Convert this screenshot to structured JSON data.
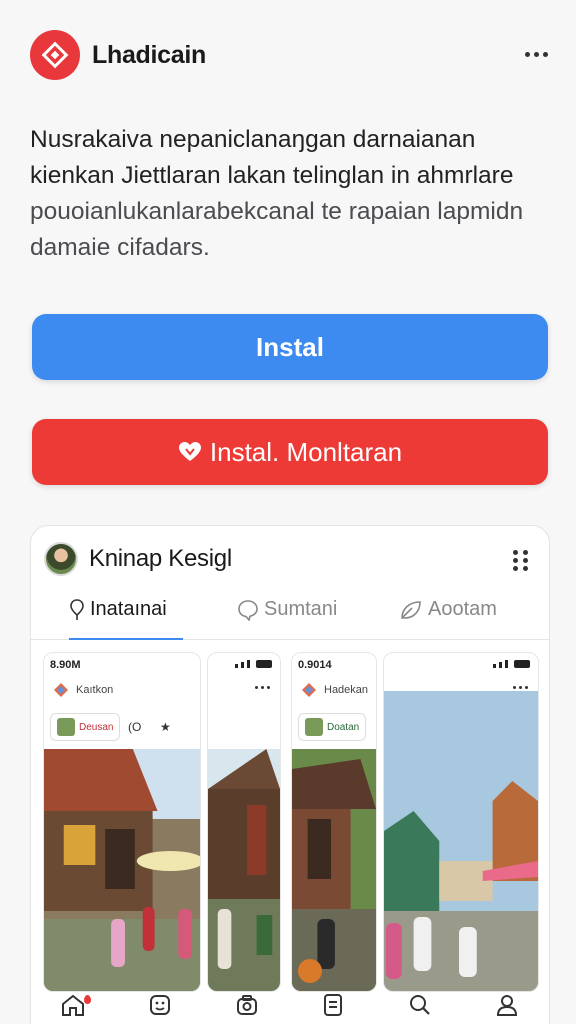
{
  "app": {
    "title": "Lhadicain",
    "brand_color": "#e8383b"
  },
  "description": {
    "lines": [
      "Nusrakaiva nepaniclanaŋgan darnaianan",
      "kienkan Jiettlaran lakan telinglan in ahmrlare",
      "pouoianlukanlarabekcanal te rapaian lapmidn",
      "damaie cifadars."
    ]
  },
  "buttons": {
    "install_label": "Instal",
    "install_color": "#3d8bf0",
    "monitor_label": "Instal. Monltaran",
    "monitor_color": "#ee3a36"
  },
  "card": {
    "title": "Kninap Kesigl",
    "tabs": [
      {
        "label": "Inataınai",
        "icon": "pin-icon",
        "active": true
      },
      {
        "label": "Sumtani",
        "icon": "chat-icon",
        "active": false
      },
      {
        "label": "Aootam",
        "icon": "leaf-icon",
        "active": false
      }
    ],
    "posts": [
      {
        "time": "8.90M",
        "user": "Kaıtkon",
        "chip": "Deusan",
        "actions": [
          "(O",
          "★"
        ]
      },
      {
        "time": "",
        "user": "",
        "chip": "",
        "actions": []
      },
      {
        "time": "0.9014",
        "user": "Hadekan",
        "chip": "Doatan",
        "actions": []
      },
      {
        "time": "",
        "user": "",
        "chip": "",
        "actions": []
      }
    ]
  },
  "bottom_nav": [
    {
      "name": "home-icon"
    },
    {
      "name": "face-icon"
    },
    {
      "name": "camera-icon"
    },
    {
      "name": "document-icon"
    },
    {
      "name": "search-icon"
    },
    {
      "name": "profile-icon"
    }
  ]
}
